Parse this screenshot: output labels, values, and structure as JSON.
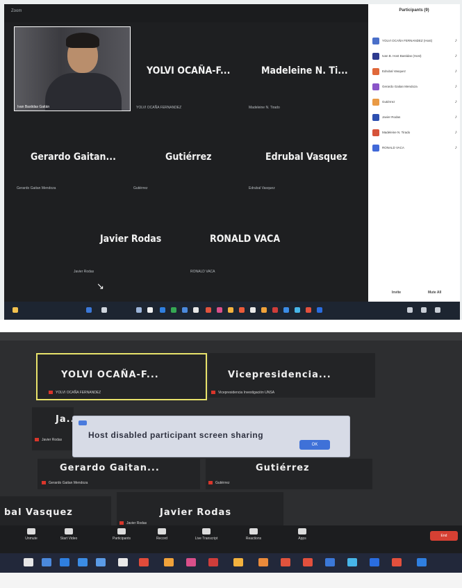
{
  "screenshot1": {
    "app_title": "Zoom",
    "video_participant": "Ivan Bastidas Gaitán",
    "tiles": [
      {
        "label": "YOLVI OCAÑA-F...",
        "sub": "YOLVI OCAÑA FERNANDEZ"
      },
      {
        "label": "Madeleine N. Ti...",
        "sub": "Madeleine N. Tirado"
      },
      {
        "label": "Gerardo Gaitan...",
        "sub": "Gerardo Gaitan Mendoza"
      },
      {
        "label": "Gutiérrez",
        "sub": "Gutiérrez"
      },
      {
        "label": "Edrubal Vasquez",
        "sub": "Edrubal Vasquez"
      },
      {
        "label": "Javier Rodas",
        "sub": "Javier Rodas"
      },
      {
        "label": "RONALD VACA",
        "sub": "RONALD VACA"
      }
    ],
    "panel": {
      "title": "Participants (9)",
      "participants": [
        {
          "name": "YOLVI OCAÑA FERNANDEZ (Host)",
          "color": "#4a6fc9"
        },
        {
          "name": "Ivan B. Host Bastidas (Host)",
          "color": "#2e3b8f"
        },
        {
          "name": "Edrubal Vasquez",
          "color": "#e0683a"
        },
        {
          "name": "Gerardo Gaitan Mendoza",
          "color": "#8a55c8"
        },
        {
          "name": "Gutiérrez",
          "color": "#e99a45"
        },
        {
          "name": "Javier Rodas",
          "color": "#2d4fb0"
        },
        {
          "name": "Madeleine N. Tirado",
          "color": "#d6533a"
        },
        {
          "name": "RONALD VACA",
          "color": "#4169d8"
        }
      ],
      "invite_label": "Invite",
      "mute_all_label": "Mute All"
    }
  },
  "screenshot2": {
    "tiles": [
      {
        "label": "YOLVI OCAÑA-F...",
        "sub": "YOLVI OCAÑA FERNANDEZ"
      },
      {
        "label": "Vicepresidencia...",
        "sub": "Vicepresidencia Investigación UNSA"
      },
      {
        "label": "Ja...",
        "sub": "Javier Rodas"
      },
      {
        "label": "Gerardo Gaitan...",
        "sub": "Gerardo Gaitan Mendoza"
      },
      {
        "label": "Gutiérrez",
        "sub": "Gutiérrez"
      },
      {
        "label": "bal Vasquez",
        "sub": ""
      },
      {
        "label": "Javier Rodas",
        "sub": "Javier Rodas"
      }
    ],
    "dialog": {
      "message": "Host disabled participant screen sharing",
      "ok_label": "OK"
    },
    "controls": [
      {
        "label": "Unmute"
      },
      {
        "label": "Start Video"
      },
      {
        "label": "Participants"
      },
      {
        "label": "Record"
      },
      {
        "label": "Live Transcript"
      },
      {
        "label": "Reactions"
      },
      {
        "label": "Apps"
      }
    ],
    "end_label": "End"
  },
  "colors": {
    "zoom_dark": "#1e1f21",
    "panel_bg": "#ffffff",
    "dialog_bg": "#d7dbe6",
    "ok_blue": "#3f71d8",
    "end_red": "#d64033"
  }
}
